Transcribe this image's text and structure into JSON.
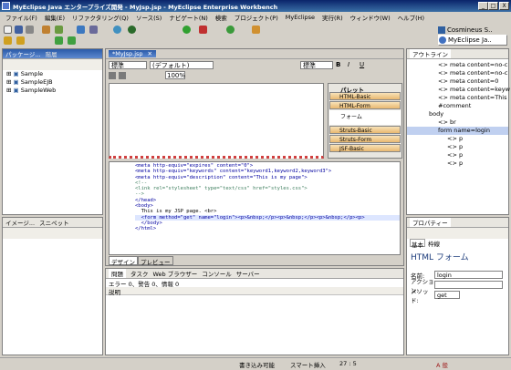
{
  "window": {
    "title": "MyEclipse Java エンタープライズ開発 - MyJsp.jsp - MyEclipse Enterprise Workbench",
    "min": "_",
    "max": "□",
    "close": "X"
  },
  "menu": [
    "ファイル(F)",
    "編集(E)",
    "リファクタリング(Q)",
    "ソース(S)",
    "ナビゲート(N)",
    "検索",
    "プロジェクト(P)",
    "MyEclipse",
    "実行(R)",
    "ウィンドウ(W)",
    "ヘルプ(H)"
  ],
  "perspectives": {
    "item1": "Cosmineus S..",
    "item2": "MyEclipse Ja.."
  },
  "package": {
    "tab1": "パッケージ...",
    "tab2": "階層",
    "items": [
      "Sample",
      "SampleEJB",
      "SampleWeb"
    ]
  },
  "image": {
    "tab1": "イメージ...",
    "tab2": "スニペット"
  },
  "editor": {
    "tab": "*MyJsp.jsp",
    "style": "標準",
    "font": "(デフォルト)",
    "size": "標準",
    "bold": "B",
    "italic": "I",
    "underline": "U",
    "zoom": "100%"
  },
  "palette": {
    "title": "パレット",
    "items": [
      "HTML-Basic",
      "HTML-Form",
      "フォーム",
      "Struts-Basic",
      "Struts-Form",
      "JSF-Basic"
    ]
  },
  "code": [
    "<meta http-equiv=\"expires\" content=\"0\">",
    "<meta http-equiv=\"keywords\" content=\"keyword1,keyword2,keyword3\">",
    "<meta http-equiv=\"description\" content=\"This is my page\">",
    "<!--",
    "<link rel=\"stylesheet\" type=\"text/css\" href=\"styles.css\">",
    "-->",
    "",
    "</head>",
    "",
    "<body>",
    "  This is my JSP page. <br>",
    "  <form method=\"get\" name=\"login\"><p>&nbsp;</p><p>&nbsp;</p><p>&nbsp;</p><p>",
    "  </body>",
    "</html>"
  ],
  "editorTabs": {
    "design": "デザイン",
    "preview": "プレビュー"
  },
  "bottom": {
    "tabs": [
      "問題",
      "タスク",
      "Web ブラウザー",
      "コンソール",
      "サーバー"
    ],
    "summary": "エラー 0、警告 0、情報 0",
    "col": "説明"
  },
  "outline": {
    "tab": "アウトライン",
    "items": [
      "<> meta content=no-c",
      "<> meta content=no-c",
      "<> meta content=0",
      "<> meta content=keyw",
      "<> meta content=This",
      "#comment",
      "body",
      "<> br",
      "form name=login",
      "<> p",
      "<> p",
      "<> p",
      "<> p"
    ]
  },
  "props": {
    "tab": "プロパティー",
    "tabBasic": "基本",
    "tabBorder": "枠線",
    "heading": "HTML フォーム",
    "nameLabel": "名前:",
    "nameValue": "login",
    "actionLabel": "アクション:",
    "methodLabel": "メソッド:",
    "methodValue": "get"
  },
  "status": {
    "writable": "書き込み可能",
    "insert": "スマート挿入",
    "pos": "27 : 5",
    "ime": "A 般"
  }
}
